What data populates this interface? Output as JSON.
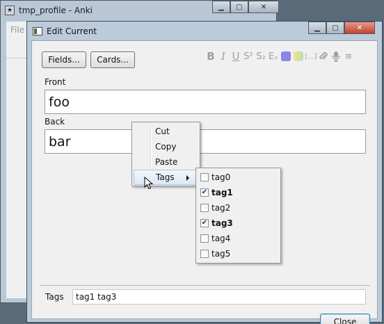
{
  "background_window": {
    "title": "tmp_profile - Anki",
    "menu_partial": "File"
  },
  "window": {
    "title": "Edit Current",
    "buttons": {
      "fields": "Fields...",
      "cards": "Cards..."
    },
    "format_toolbar": [
      {
        "name": "bold-icon",
        "glyph": "B"
      },
      {
        "name": "italic-icon",
        "glyph": "I"
      },
      {
        "name": "underline-icon",
        "glyph": "U"
      },
      {
        "name": "superscript-icon",
        "glyph": "S²"
      },
      {
        "name": "subscript-icon",
        "glyph": "S₂"
      },
      {
        "name": "clear-format-icon",
        "glyph": "Eₓ"
      },
      {
        "name": "text-color-icon",
        "glyph": "",
        "color": "#8a86e6"
      },
      {
        "name": "highlight-color-icon",
        "glyph": "",
        "color": "#c0e0c0"
      },
      {
        "name": "cloze-icon",
        "glyph": "[...]"
      },
      {
        "name": "attach-icon",
        "glyph": "🖇"
      },
      {
        "name": "record-audio-icon",
        "glyph": "🎙"
      },
      {
        "name": "more-menu-icon",
        "glyph": "≡"
      }
    ],
    "fields": [
      {
        "label": "Front",
        "value": "foo"
      },
      {
        "label": "Back",
        "value": "bar"
      }
    ],
    "tags_label": "Tags",
    "tags_value": "tag1 tag3",
    "close_label": "Close"
  },
  "context_menu": {
    "items": [
      "Cut",
      "Copy",
      "Paste"
    ],
    "tags_item": "Tags"
  },
  "tags_submenu": [
    {
      "label": "tag0",
      "checked": false
    },
    {
      "label": "tag1",
      "checked": true
    },
    {
      "label": "tag2",
      "checked": false
    },
    {
      "label": "tag3",
      "checked": true
    },
    {
      "label": "tag4",
      "checked": false
    },
    {
      "label": "tag5",
      "checked": false
    }
  ],
  "colors": {
    "highlight_border": "#a8c6ea",
    "window_frame": "#bccbdb"
  }
}
